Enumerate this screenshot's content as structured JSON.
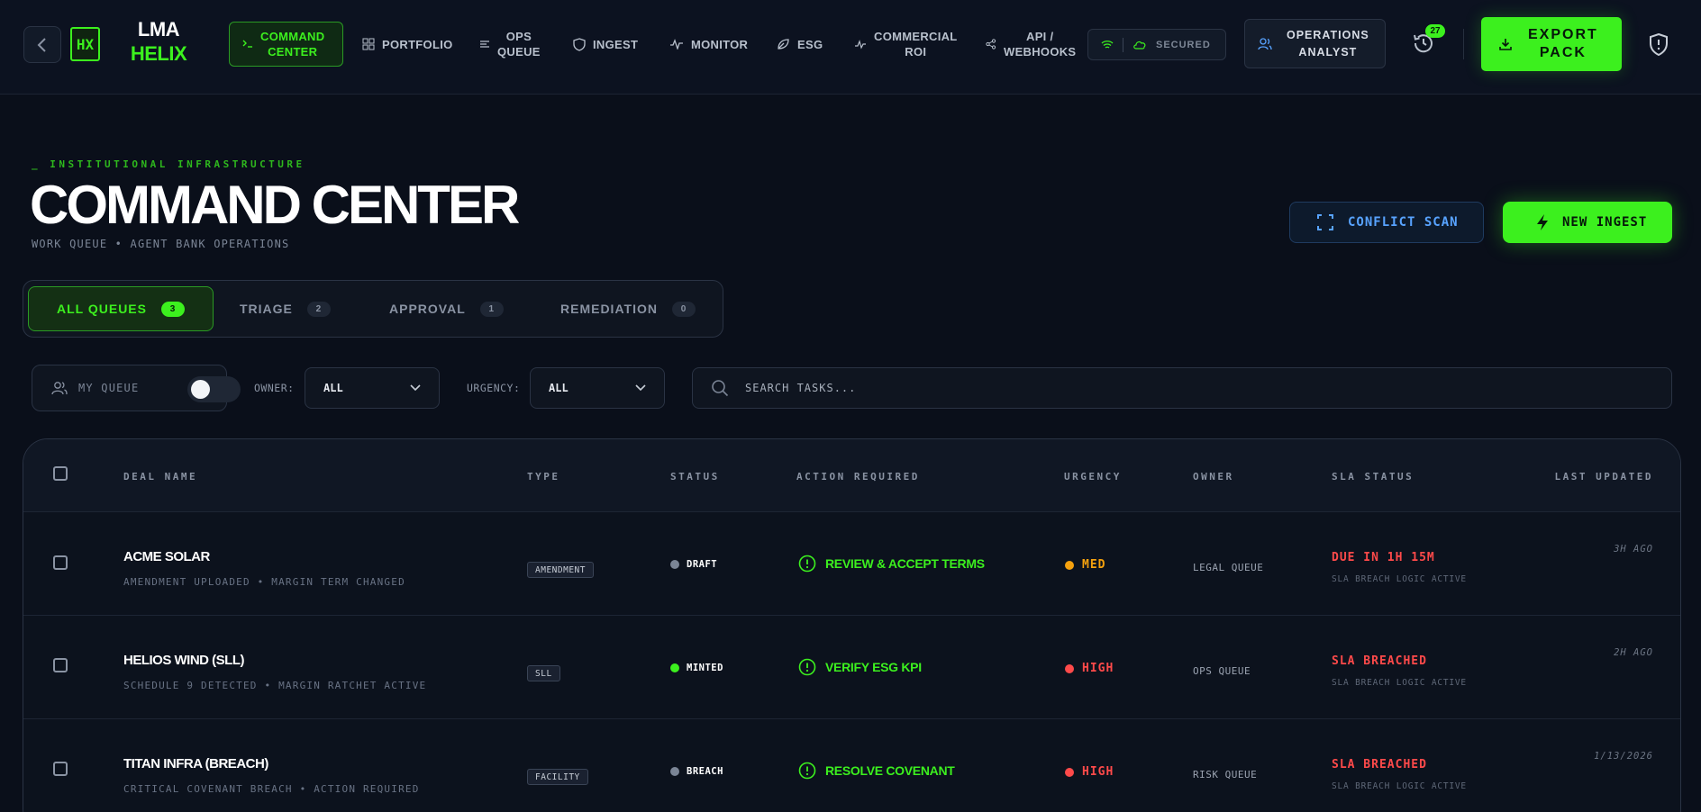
{
  "brand": {
    "badge": "HX",
    "line1": "LMA",
    "line2": "HELIX"
  },
  "nav": [
    {
      "label": "COMMAND\nCENTER",
      "icon": "terminal-icon",
      "active": true
    },
    {
      "label": "PORTFOLIO",
      "icon": "grid-icon"
    },
    {
      "label": "OPS\nQUEUE",
      "icon": "list-icon"
    },
    {
      "label": "INGEST",
      "icon": "shield-icon"
    },
    {
      "label": "MONITOR",
      "icon": "activity-icon"
    },
    {
      "label": "ESG",
      "icon": "leaf-icon"
    },
    {
      "label": "COMMERCIAL\nROI",
      "icon": "pulse-icon"
    },
    {
      "label": "API /\nWEBHOOKS",
      "icon": "share-icon"
    }
  ],
  "header": {
    "secured_label": "SECURED",
    "role_label": "OPERATIONS\nANALYST",
    "notification_count": "27",
    "export_label": "EXPORT\nPACK"
  },
  "hero": {
    "eyebrow": "_ INSTITUTIONAL INFRASTRUCTURE",
    "title": "COMMAND CENTER",
    "subtitle": "WORK QUEUE • AGENT BANK OPERATIONS",
    "conflict_scan_label": "CONFLICT SCAN",
    "new_ingest_label": "NEW INGEST"
  },
  "tabs": [
    {
      "label": "ALL QUEUES",
      "count": "3",
      "active": true
    },
    {
      "label": "TRIAGE",
      "count": "2"
    },
    {
      "label": "APPROVAL",
      "count": "1"
    },
    {
      "label": "REMEDIATION",
      "count": "0"
    }
  ],
  "filters": {
    "my_queue_label": "MY QUEUE",
    "my_queue_on": false,
    "owner_label": "OWNER:",
    "owner_value": "ALL",
    "urgency_label": "URGENCY:",
    "urgency_value": "ALL",
    "search_placeholder": "SEARCH TASKS..."
  },
  "table": {
    "columns": [
      "DEAL NAME",
      "TYPE",
      "STATUS",
      "ACTION REQUIRED",
      "URGENCY",
      "OWNER",
      "SLA STATUS",
      "LAST UPDATED"
    ],
    "rows": [
      {
        "deal": "ACME SOLAR",
        "sub": "AMENDMENT UPLOADED • MARGIN TERM CHANGED",
        "type": "AMENDMENT",
        "status": "DRAFT",
        "status_color": "#7b8596",
        "action": "REVIEW & ACCEPT TERMS",
        "urgency": "MED",
        "urgency_color": "#f5a10e",
        "owner": "LEGAL QUEUE",
        "sla": "DUE IN 1H 15M",
        "sla_sub": "SLA BREACH LOGIC ACTIVE",
        "updated": "3H AGO"
      },
      {
        "deal": "HELIOS WIND (SLL)",
        "sub": "SCHEDULE 9 DETECTED • MARGIN RATCHET ACTIVE",
        "type": "SLL",
        "status": "MINTED",
        "status_color": "#3cf01e",
        "action": "VERIFY ESG KPI",
        "urgency": "HIGH",
        "urgency_color": "#ff4a4a",
        "owner": "OPS QUEUE",
        "sla": "SLA BREACHED",
        "sla_sub": "SLA BREACH LOGIC ACTIVE",
        "updated": "2H AGO"
      },
      {
        "deal": "TITAN INFRA (BREACH)",
        "sub": "CRITICAL COVENANT BREACH • ACTION REQUIRED",
        "type": "FACILITY",
        "status": "BREACH",
        "status_color": "#7b8596",
        "action": "RESOLVE COVENANT",
        "urgency": "HIGH",
        "urgency_color": "#ff4a4a",
        "owner": "RISK QUEUE",
        "sla": "SLA BREACHED",
        "sla_sub": "SLA BREACH LOGIC ACTIVE",
        "updated": "1/13/2026"
      }
    ]
  },
  "colors": {
    "accent": "#3cf01e",
    "bg": "#0a0f1a",
    "danger": "#ff4a4a",
    "warn": "#f5a10e",
    "info": "#58a3ff"
  }
}
